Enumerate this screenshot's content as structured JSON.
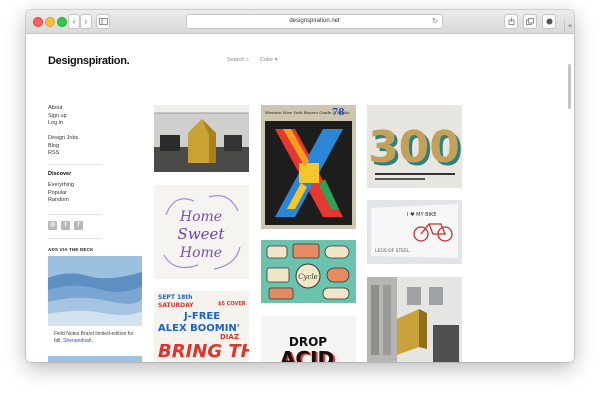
{
  "browser": {
    "url": "designspiration.net",
    "back_glyph": "‹",
    "forward_glyph": "›",
    "plus_glyph": "+"
  },
  "header": {
    "logo": "Designspiration.",
    "search_label": "Search",
    "color_label": "Color"
  },
  "sidebar": {
    "links1": [
      "About",
      "Sign up",
      "Log in"
    ],
    "links2": [
      "Design Jobs",
      "Blog",
      "RSS"
    ],
    "discover_title": "Discover",
    "discover_links": [
      "Everything",
      "Popular",
      "Random"
    ],
    "social": [
      "instagram-icon",
      "twitter-icon",
      "facebook-icon"
    ]
  },
  "ad": {
    "title": "ADS VIA THE DECK",
    "text": "Field Notes Brand limited-edition for fall,",
    "link": "Shenandoah."
  },
  "tiles": {
    "home_sweet_home": {
      "line1": "Home",
      "line2": "Sweet",
      "line3": "Home"
    },
    "poster_x": {
      "header": "Western New York Buyers Guide & Books",
      "number": "78"
    },
    "number_300": "300",
    "bike": {
      "text": "I ♥ MY BIKE",
      "sub": "LEGS OF STEEL"
    },
    "cycle_badge": "Cycle",
    "poster_event": {
      "date": "SEPT 18th",
      "day": "SATURDAY",
      "cover": "$5 COVER",
      "line1": "J-FREE",
      "line2": "ALEX BOOMIN'",
      "line3": "DIAZ",
      "big": "BRING THE"
    },
    "drop_acid": {
      "line1": "DROP",
      "line2": "ACID"
    }
  },
  "colors": {
    "link_blue": "#1a56c4",
    "text_dark": "#111111"
  }
}
